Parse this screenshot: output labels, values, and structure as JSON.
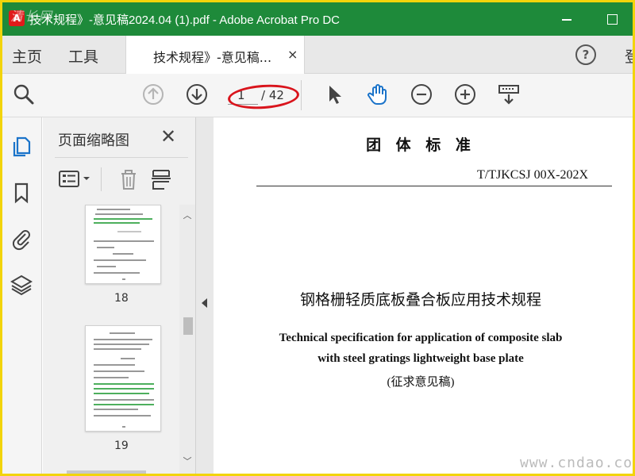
{
  "window": {
    "title": "技术规程》-意见稿2024.04 (1).pdf - Adobe Acrobat Pro DC",
    "app_icon": "acrobat-icon",
    "watermark_top_left": "清长网"
  },
  "tabs": {
    "home": "主页",
    "tools": "工具",
    "document_tab": "技术规程》-意见稿...",
    "close_glyph": "×",
    "signin": "登"
  },
  "toolbar": {
    "page_current": "1",
    "page_total": "/ 42"
  },
  "thumbnail_panel": {
    "title": "页面缩略图",
    "close_glyph": "✕",
    "pages": [
      {
        "label": "18"
      },
      {
        "label": "19"
      }
    ]
  },
  "document": {
    "standard_heading": "团 体 标 准",
    "standard_code": "T/TJKCSJ 00X-202X",
    "chinese_title": "钢格栅轻质底板叠合板应用技术规程",
    "english_title_line1": "Technical specification for application of composite slab",
    "english_title_line2": "with steel gratings lightweight base plate",
    "draft_note": "(征求意见稿)"
  },
  "watermark": {
    "bottom_right": "www.cndao.com"
  },
  "colors": {
    "titlebar": "#1e8a3a",
    "frame_border": "#f2d40b",
    "highlight_ellipse": "#d9141c",
    "hand_tool_active": "#1a73c9"
  }
}
